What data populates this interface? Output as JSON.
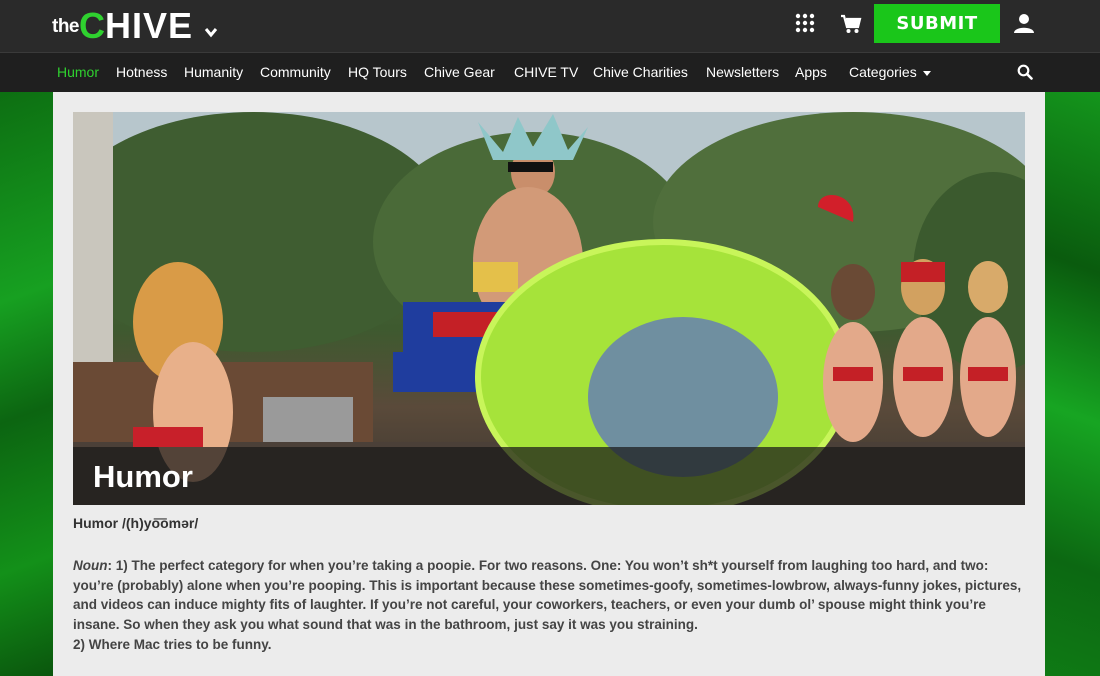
{
  "header": {
    "logo_the": "the",
    "logo_c": "C",
    "logo_rest": "HIVE",
    "submit_label": "SUBMIT",
    "icons": [
      "chevron-down-icon",
      "grid-icon",
      "cart-icon",
      "user-icon"
    ]
  },
  "nav": {
    "items": [
      {
        "label": "Humor",
        "active": true
      },
      {
        "label": "Hotness"
      },
      {
        "label": "Humanity"
      },
      {
        "label": "Community"
      },
      {
        "label": "HQ Tours"
      },
      {
        "label": "Chive Gear"
      },
      {
        "label": "CHIVE TV"
      },
      {
        "label": "Chive Charities"
      },
      {
        "label": "Newsletters"
      },
      {
        "label": "Apps"
      },
      {
        "label": "Categories"
      }
    ],
    "search_icon": "search-icon"
  },
  "hero": {
    "title": "Humor"
  },
  "definition": {
    "term": "Humor /(h)yo͞omər/",
    "noun_label": "Noun",
    "body": ": 1) The perfect category for when you’re taking a poopie. For two reasons. One: You won’t sh*t yourself from laughing too hard, and two: you’re (probably) alone when you’re pooping. This is important because these sometimes-goofy, sometimes-lowbrow, always-funny jokes, pictures, and videos can induce mighty fits of laughter. If you’re not careful, your coworkers, teachers, or even your dumb ol’ spouse might think you’re insane. So when they ask you what sound that was in the bathroom, just say it was you straining.",
    "line2": "2) Where Mac tries to be funny."
  },
  "colors": {
    "accent": "#1ac61a",
    "header_bg": "#2a2a2a",
    "nav_bg": "#1f1f1f",
    "panel_bg": "#ececec"
  }
}
